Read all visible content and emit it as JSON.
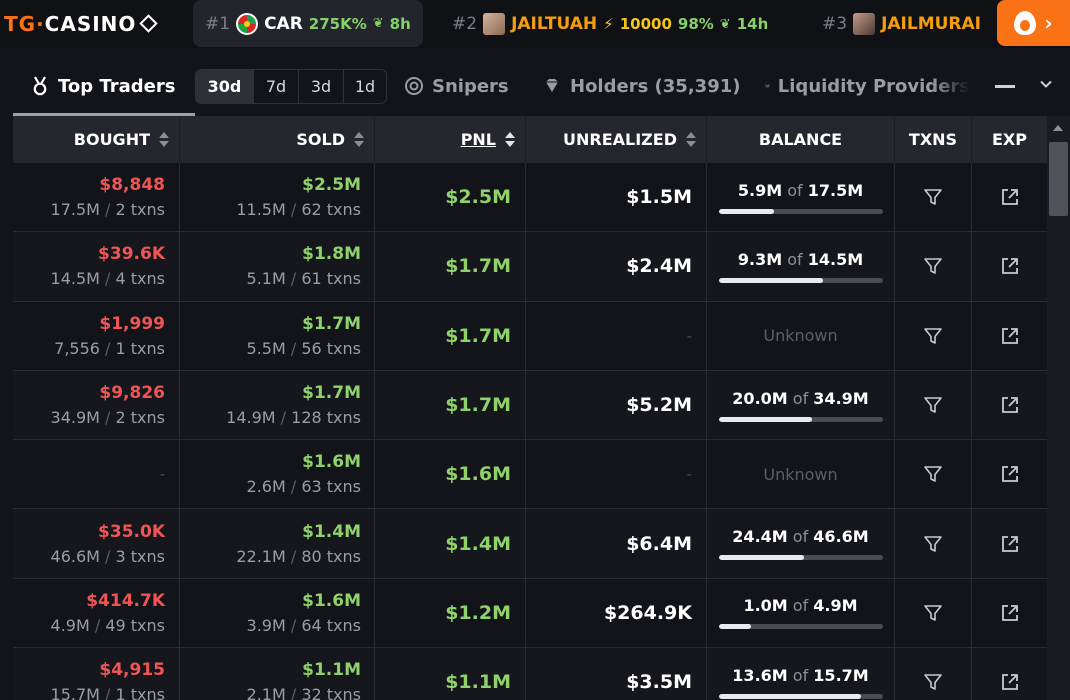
{
  "ticker": {
    "logo_tg": "TG",
    "logo_dot": "·",
    "logo_casino": "CASINO",
    "items": [
      {
        "rank": "#1",
        "symbol": "CAR",
        "change": "275K%",
        "age": "8h"
      },
      {
        "rank": "#2",
        "symbol": "JAILTUAH",
        "boost": "10000",
        "change": "98%",
        "age": "14h"
      },
      {
        "rank": "#3",
        "symbol": "JAILMURAI"
      }
    ],
    "fire_arrow": "›"
  },
  "tabs": {
    "top_traders": "Top Traders",
    "periods": [
      "30d",
      "7d",
      "3d",
      "1d"
    ],
    "active_period": "30d",
    "snipers": "Snipers",
    "holders": "Holders (35,391)",
    "liquidity": "Liquidity Providers"
  },
  "table": {
    "headers": {
      "bought": "BOUGHT",
      "sold": "SOLD",
      "pnl": "PNL",
      "unrealized": "UNREALIZED",
      "balance": "BALANCE",
      "txns": "TXNS",
      "exp": "EXP"
    },
    "of_word": "of",
    "rows": [
      {
        "bought_usd": "$8,848",
        "bought_amt": "17.5M",
        "bought_txns": "2 txns",
        "sold_usd": "$2.5M",
        "sold_amt": "11.5M",
        "sold_txns": "62 txns",
        "pnl": "$2.5M",
        "unrealized": "$1.5M",
        "bal_held": "5.9M",
        "bal_total": "17.5M",
        "bal_fraction": 0.34,
        "known": true
      },
      {
        "bought_usd": "$39.6K",
        "bought_amt": "14.5M",
        "bought_txns": "4 txns",
        "sold_usd": "$1.8M",
        "sold_amt": "5.1M",
        "sold_txns": "61 txns",
        "pnl": "$1.7M",
        "unrealized": "$2.4M",
        "bal_held": "9.3M",
        "bal_total": "14.5M",
        "bal_fraction": 0.64,
        "known": true
      },
      {
        "bought_usd": "$1,999",
        "bought_amt": "7,556",
        "bought_txns": "1 txns",
        "sold_usd": "$1.7M",
        "sold_amt": "5.5M",
        "sold_txns": "56 txns",
        "pnl": "$1.7M",
        "unrealized": "-",
        "unknown": "Unknown",
        "known": false
      },
      {
        "bought_usd": "$9,826",
        "bought_amt": "34.9M",
        "bought_txns": "2 txns",
        "sold_usd": "$1.7M",
        "sold_amt": "14.9M",
        "sold_txns": "128 txns",
        "pnl": "$1.7M",
        "unrealized": "$5.2M",
        "bal_held": "20.0M",
        "bal_total": "34.9M",
        "bal_fraction": 0.57,
        "known": true
      },
      {
        "bought_usd": "-",
        "bought_amt": "",
        "bought_txns": "",
        "sold_usd": "$1.6M",
        "sold_amt": "2.6M",
        "sold_txns": "63 txns",
        "pnl": "$1.6M",
        "unrealized": "-",
        "unknown": "Unknown",
        "known": false
      },
      {
        "bought_usd": "$35.0K",
        "bought_amt": "46.6M",
        "bought_txns": "3 txns",
        "sold_usd": "$1.4M",
        "sold_amt": "22.1M",
        "sold_txns": "80 txns",
        "pnl": "$1.4M",
        "unrealized": "$6.4M",
        "bal_held": "24.4M",
        "bal_total": "46.6M",
        "bal_fraction": 0.52,
        "known": true
      },
      {
        "bought_usd": "$414.7K",
        "bought_amt": "4.9M",
        "bought_txns": "49 txns",
        "sold_usd": "$1.6M",
        "sold_amt": "3.9M",
        "sold_txns": "64 txns",
        "pnl": "$1.2M",
        "unrealized": "$264.9K",
        "bal_held": "1.0M",
        "bal_total": "4.9M",
        "bal_fraction": 0.2,
        "known": true
      },
      {
        "bought_usd": "$4,915",
        "bought_amt": "15.7M",
        "bought_txns": "1 txns",
        "sold_usd": "$1.1M",
        "sold_amt": "2.1M",
        "sold_txns": "32 txns",
        "pnl": "$1.1M",
        "unrealized": "$3.5M",
        "bal_held": "13.6M",
        "bal_total": "15.7M",
        "bal_fraction": 0.87,
        "known": true
      }
    ]
  },
  "colors": {
    "accent": "#f97316",
    "green": "#8fd16a",
    "red": "#f05555"
  }
}
